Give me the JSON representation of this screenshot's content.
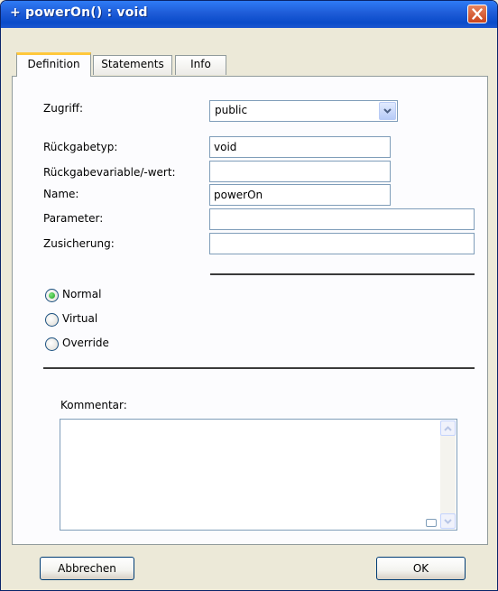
{
  "window": {
    "title": "+ powerOn() : void"
  },
  "tabs": [
    {
      "label": "Definition"
    },
    {
      "label": "Statements"
    },
    {
      "label": "Info"
    }
  ],
  "form": {
    "zugriff_label": "Zugriff:",
    "zugriff_value": "public",
    "rueckgabetyp_label": "Rückgabetyp:",
    "rueckgabetyp_value": "void",
    "rueckgabevariable_label": "Rückgabevariable/-wert:",
    "rueckgabevariable_value": "",
    "name_label": "Name:",
    "name_value": "powerOn",
    "parameter_label": "Parameter:",
    "parameter_value": "",
    "zusicherung_label": "Zusicherung:",
    "zusicherung_value": ""
  },
  "method_kind": {
    "options": [
      "Normal",
      "Virtual",
      "Override"
    ],
    "selected": "Normal"
  },
  "kommentar": {
    "label": "Kommentar:",
    "value": ""
  },
  "buttons": {
    "cancel_label": "Abbrechen",
    "ok_label": "OK"
  },
  "colors": {
    "titlebar": "#0A4BC9",
    "dialog_bg": "#ECE9D8",
    "close_button": "#D65A36",
    "active_tab_highlight": "#FFC83C",
    "radio_checked": "#21A121"
  }
}
